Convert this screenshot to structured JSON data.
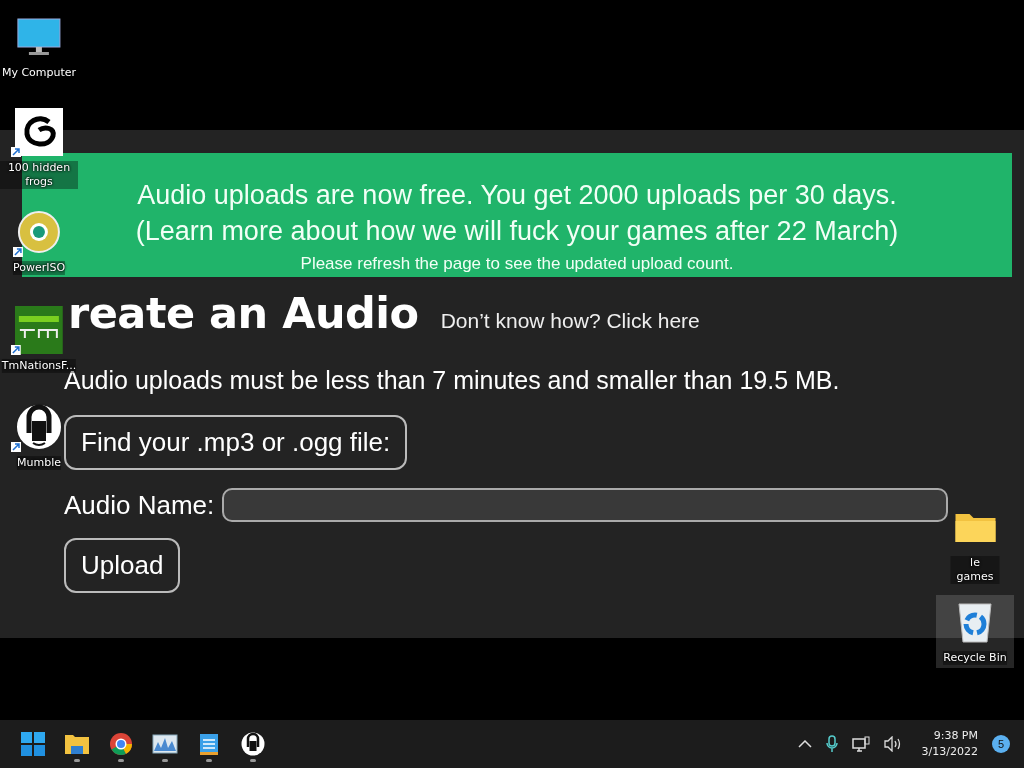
{
  "wallpaper": {
    "banner": {
      "lines": [
        "Audio uploads are now free. You get 2000 uploads per 30 days.",
        "(Learn more about how we will fuck your games after 22 March)"
      ],
      "note": "Please refresh the page to see the updated upload count."
    },
    "heading": "reate an Audio",
    "help_link": "Don’t know how? Click here",
    "limits": "Audio uploads must be less than 7 minutes and smaller than 19.5 MB.",
    "file_button": "Find your .mp3 or .ogg file:",
    "name_label": "Audio Name:",
    "upload_button": "Upload"
  },
  "desktop_icons": [
    {
      "label": "My Computer",
      "kind": "computer",
      "shortcut": false,
      "selected": false
    },
    {
      "label": "100 hidden frogs",
      "kind": "swirl",
      "shortcut": true,
      "selected": false
    },
    {
      "label": "PowerISO",
      "kind": "disc",
      "shortcut": true,
      "selected": false
    },
    {
      "label": "TmNationsF...",
      "kind": "game",
      "shortcut": true,
      "selected": false
    },
    {
      "label": "Mumble",
      "kind": "headset",
      "shortcut": true,
      "selected": false
    },
    {
      "label": "le games",
      "kind": "folder",
      "shortcut": false,
      "selected": false
    },
    {
      "label": "Recycle Bin",
      "kind": "bin",
      "shortcut": false,
      "selected": true
    }
  ],
  "taskbar": {
    "apps": [
      {
        "kind": "start",
        "running": false
      },
      {
        "kind": "folder",
        "running": true
      },
      {
        "kind": "browser",
        "running": true
      },
      {
        "kind": "monitor",
        "running": true
      },
      {
        "kind": "notepad",
        "running": true
      },
      {
        "kind": "headset",
        "running": true
      }
    ],
    "time": "9:38 PM",
    "date": "3/13/2022",
    "notifications": "5"
  }
}
